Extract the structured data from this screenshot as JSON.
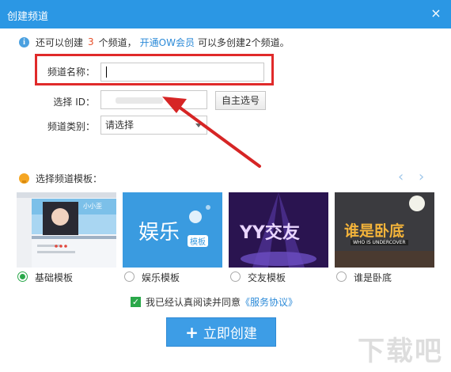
{
  "window": {
    "title": "创建频道",
    "close_symbol": "×"
  },
  "info": {
    "prefix": "还可以创建",
    "count": "3",
    "suffix": "个频道，",
    "vip_link": "开通OW会员",
    "tail": "可以多创建2个频道。"
  },
  "form": {
    "name_label": "频道名称：",
    "name_value": "",
    "id_label": "选择 ID：",
    "self_select_button": "自主选号",
    "category_label": "频道类别：",
    "category_selected": "请选择"
  },
  "templates": {
    "heading": "选择频道模板：",
    "prev_symbol": "‹",
    "next_symbol": "›",
    "items": [
      {
        "label": "基础模板",
        "selected": true
      },
      {
        "label": "娱乐模板",
        "selected": false
      },
      {
        "label": "交友模板",
        "selected": false
      },
      {
        "label": "谁是卧底",
        "selected": false
      }
    ],
    "thumb_text": {
      "basic_name": "小小歪",
      "ent_main": "娱乐",
      "ent_badge": "模板",
      "yy": "YY交友",
      "undercover_main": "谁是卧底",
      "undercover_sub": "WHO IS UNDERCOVER"
    }
  },
  "agreement": {
    "checked": true,
    "text": "我已经认真阅读并同意",
    "link": "《服务协议》"
  },
  "create_button": {
    "plus": "+",
    "label": "立即创建"
  },
  "watermark": {
    "text": "下载吧"
  },
  "colors": {
    "titlebar": "#2b97e4",
    "highlight": "#e02a2a",
    "arrow": "#d62525",
    "button": "#3d9de6",
    "accent_green": "#2aa84a"
  }
}
